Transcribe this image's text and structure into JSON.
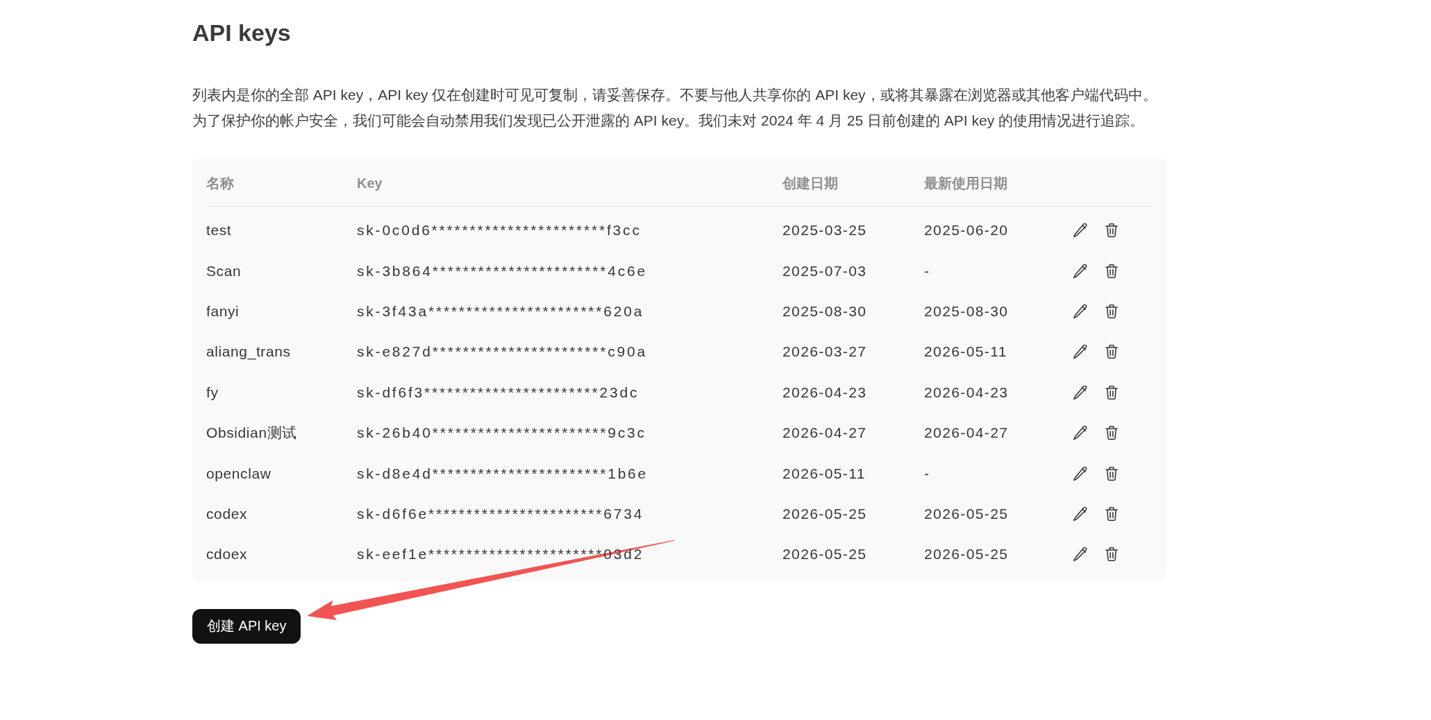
{
  "page": {
    "title": "API keys",
    "description": [
      "列表内是你的全部 API key，API key 仅在创建时可见可复制，请妥善保存。不要与他人共享你的 API key，或将其暴露在浏览器或其他客户端代码中。",
      "为了保护你的帐户安全，我们可能会自动禁用我们发现已公开泄露的 API key。我们未对 2024 年 4 月 25 日前创建的 API key 的使用情况进行追踪。"
    ]
  },
  "table": {
    "columns": [
      "名称",
      "Key",
      "创建日期",
      "最新使用日期"
    ],
    "rows": [
      {
        "name": "test",
        "key": "sk-0c0d6***********************f3cc",
        "created": "2025-03-25",
        "last_used": "2025-06-20"
      },
      {
        "name": "Scan",
        "key": "sk-3b864***********************4c6e",
        "created": "2025-07-03",
        "last_used": "-"
      },
      {
        "name": "fanyi",
        "key": "sk-3f43a***********************620a",
        "created": "2025-08-30",
        "last_used": "2025-08-30"
      },
      {
        "name": "aliang_trans",
        "key": "sk-e827d***********************c90a",
        "created": "2026-03-27",
        "last_used": "2026-05-11"
      },
      {
        "name": "fy",
        "key": "sk-df6f3***********************23dc",
        "created": "2026-04-23",
        "last_used": "2026-04-23"
      },
      {
        "name": "Obsidian测试",
        "key": "sk-26b40***********************9c3c",
        "created": "2026-04-27",
        "last_used": "2026-04-27"
      },
      {
        "name": "openclaw",
        "key": "sk-d8e4d***********************1b6e",
        "created": "2026-05-11",
        "last_used": "-"
      },
      {
        "name": "codex",
        "key": "sk-d6f6e***********************6734",
        "created": "2026-05-25",
        "last_used": "2026-05-25"
      },
      {
        "name": "cdoex",
        "key": "sk-eef1e***********************03d2",
        "created": "2026-05-25",
        "last_used": "2026-05-25"
      }
    ]
  },
  "create_button": {
    "label": "创建 API key"
  }
}
